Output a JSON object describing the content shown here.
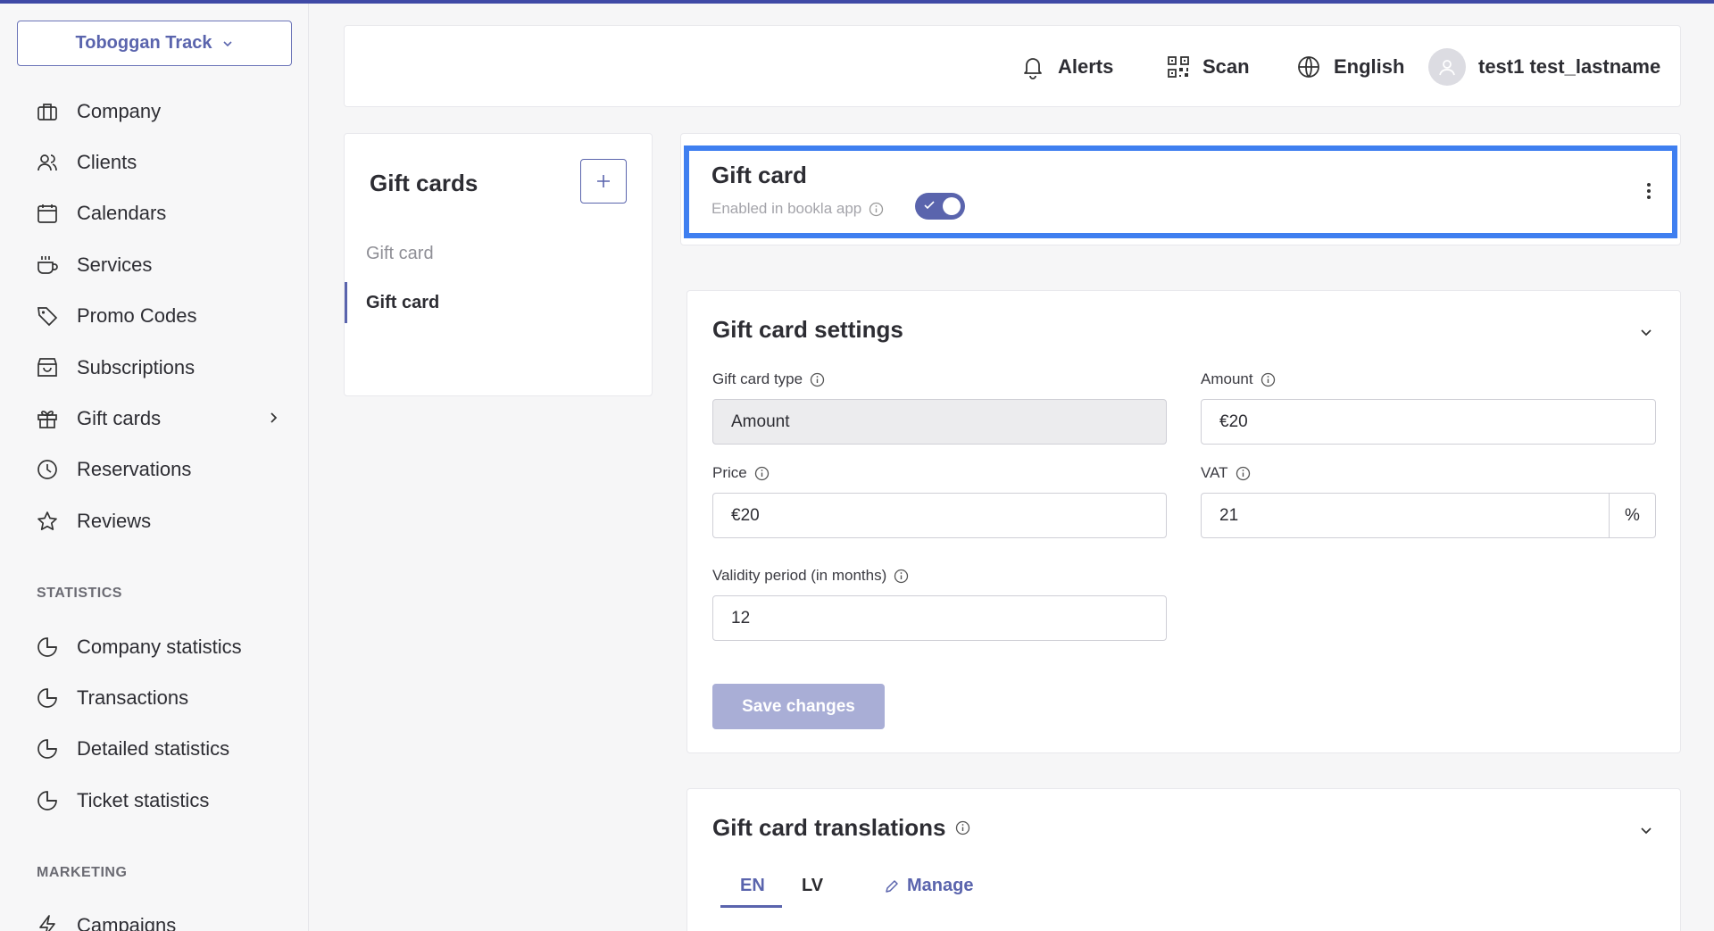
{
  "company_selector": {
    "label": "Toboggan Track"
  },
  "nav": {
    "items": [
      {
        "label": "Company",
        "icon": "briefcase-icon"
      },
      {
        "label": "Clients",
        "icon": "users-icon"
      },
      {
        "label": "Calendars",
        "icon": "calendar-icon"
      },
      {
        "label": "Services",
        "icon": "coffee-icon"
      },
      {
        "label": "Promo Codes",
        "icon": "tag-icon"
      },
      {
        "label": "Subscriptions",
        "icon": "bag-icon"
      },
      {
        "label": "Gift cards",
        "icon": "gift-icon"
      },
      {
        "label": "Reservations",
        "icon": "clock-icon"
      },
      {
        "label": "Reviews",
        "icon": "star-icon"
      }
    ],
    "statistics_title": "STATISTICS",
    "statistics": [
      {
        "label": "Company statistics"
      },
      {
        "label": "Transactions"
      },
      {
        "label": "Detailed statistics"
      },
      {
        "label": "Ticket statistics"
      }
    ],
    "marketing_title": "MARKETING",
    "marketing": [
      {
        "label": "Campaigns"
      }
    ]
  },
  "header": {
    "alerts": "Alerts",
    "scan": "Scan",
    "language": "English",
    "user": "test1 test_lastname"
  },
  "gift_list": {
    "title": "Gift cards",
    "items": [
      {
        "label": "Gift card"
      },
      {
        "label": "Gift card"
      }
    ]
  },
  "gift_card": {
    "title": "Gift card",
    "enabled_label": "Enabled in bookla app",
    "enabled": true
  },
  "settings": {
    "title": "Gift card settings",
    "type_label": "Gift card type",
    "type_value": "Amount",
    "amount_label": "Amount",
    "amount_value": "€20",
    "price_label": "Price",
    "price_value": "€20",
    "vat_label": "VAT",
    "vat_value": "21",
    "vat_suffix": "%",
    "validity_label": "Validity period (in months)",
    "validity_value": "12",
    "save_label": "Save changes"
  },
  "translations": {
    "title": "Gift card translations",
    "tabs": [
      "EN",
      "LV"
    ],
    "manage_label": "Manage"
  },
  "colors": {
    "accent": "#5a64ad",
    "highlight": "#3f7ff0",
    "topline": "#3f4aa6"
  }
}
